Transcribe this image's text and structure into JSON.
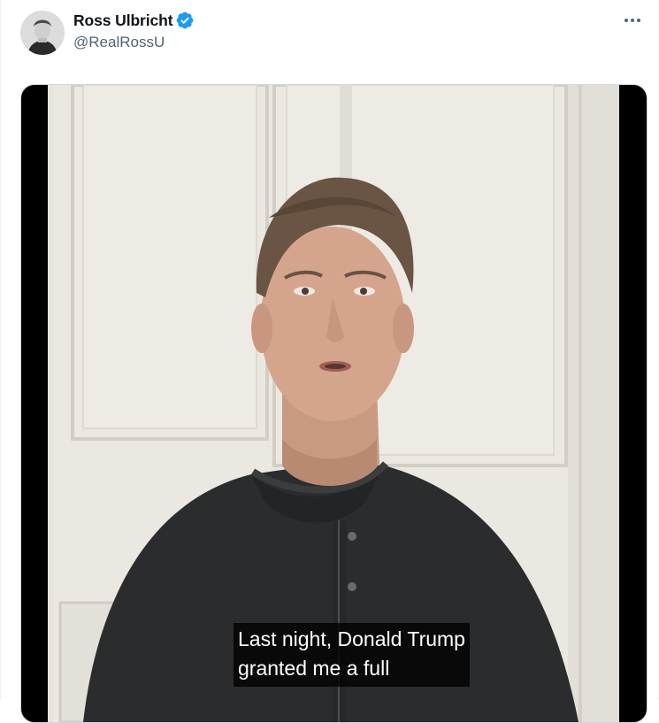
{
  "tweet": {
    "author_name": "Ross Ulbricht",
    "handle": "@RealRossU",
    "verified": true,
    "accent_color": "#1d9bf0"
  },
  "icons": {
    "verified": "verified-badge-icon",
    "more": "more-horizontal-icon"
  },
  "video": {
    "subtitle_line1": "Last night, Donald Trump",
    "subtitle_line2": "granted me a full"
  }
}
